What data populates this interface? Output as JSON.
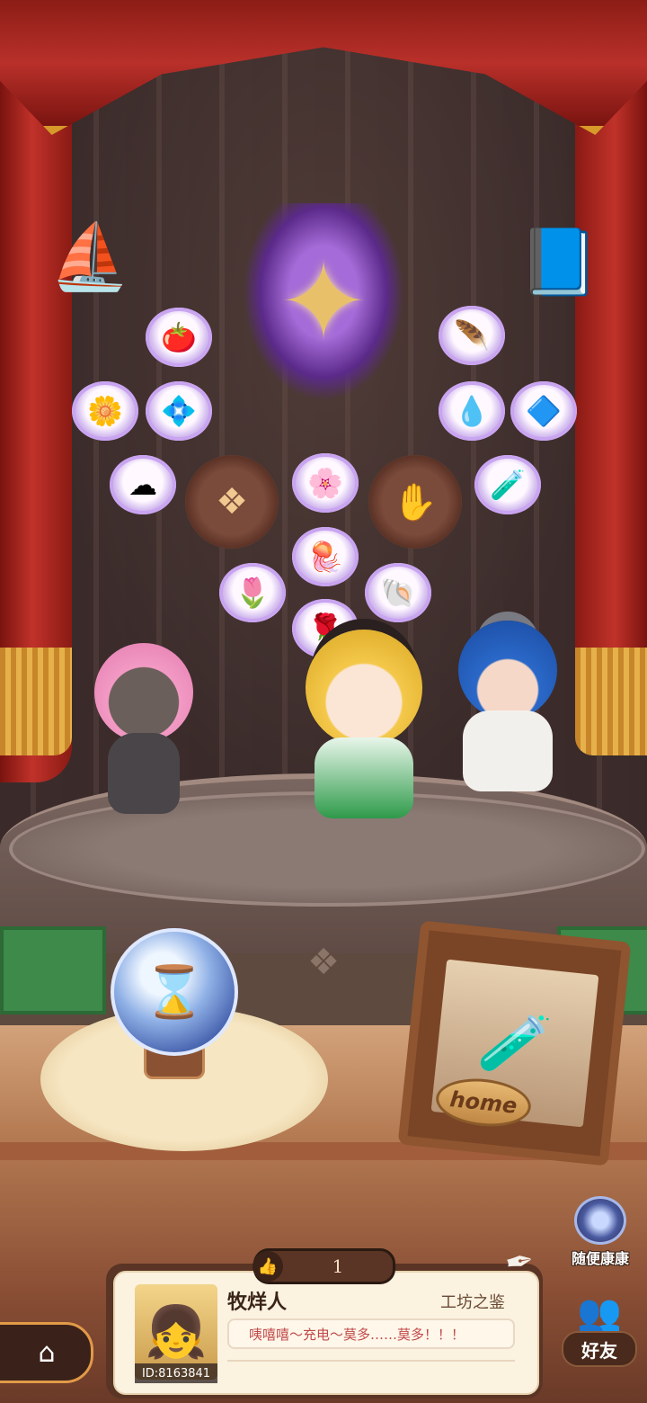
{
  "collection": {
    "emblem_icon": "purple-star-emblem-icon",
    "corner_left_icon": "ship-trinket-icon",
    "corner_right_icon": "book-trinket-icon",
    "items": [
      {
        "name": "tomato-item-icon",
        "glyph": "🍅"
      },
      {
        "name": "feather-item-icon",
        "glyph": "🪶"
      },
      {
        "name": "golden-flower-item-icon",
        "glyph": "🌼"
      },
      {
        "name": "blue-flower-item-icon",
        "glyph": "💠"
      },
      {
        "name": "blue-slime-item-icon",
        "glyph": "💧"
      },
      {
        "name": "crystal-item-icon",
        "glyph": "🔷"
      },
      {
        "name": "cotton-item-icon",
        "glyph": "☁"
      },
      {
        "name": "white-flower-item-icon",
        "glyph": "🌸"
      },
      {
        "name": "potion-item-icon",
        "glyph": "🧪"
      },
      {
        "name": "jellyfish-item-icon",
        "glyph": "🪼"
      },
      {
        "name": "lily-item-icon",
        "glyph": "🌷"
      },
      {
        "name": "shell-item-icon",
        "glyph": "🐚"
      },
      {
        "name": "yellow-rose-item-icon",
        "glyph": "🌹"
      }
    ],
    "medals": [
      {
        "name": "locked-medal-left-icon",
        "glyph": "❖"
      },
      {
        "name": "locked-medal-right-icon",
        "glyph": "✋"
      }
    ]
  },
  "hourglass": {
    "glyph": "⌛"
  },
  "home_frame": {
    "plaque": "home",
    "glyph": "🧪"
  },
  "random_visit": {
    "label": "随便康康"
  },
  "friends": {
    "label": "好友",
    "glyph": "👥"
  },
  "home_button": {
    "glyph": "⌂"
  },
  "likes": {
    "count": "1",
    "glyph": "👍"
  },
  "profile": {
    "name": "牧烊人",
    "title": "工坊之鉴",
    "message": "咦嘻嘻～充电～莫多……莫多！！！",
    "uid": "ID:8163841",
    "avatar_glyph": "👧"
  },
  "quill": {
    "glyph": "✒"
  },
  "colors": {
    "curtain": "#b9302a",
    "fringe": "#e6b14a",
    "panel": "#5a3424",
    "card": "#fbf2e0",
    "message_text": "#c04a4a"
  }
}
